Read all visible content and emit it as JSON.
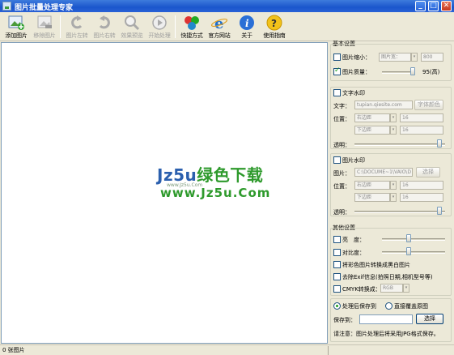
{
  "window": {
    "title": "图片批量处理专家",
    "min_glyph": "_",
    "max_glyph": "□",
    "close_glyph": "✕"
  },
  "toolbar": {
    "items": [
      {
        "label": "添加图片",
        "icon": "add-image-icon",
        "enabled": true
      },
      {
        "label": "移除图片",
        "icon": "remove-image-icon",
        "enabled": false
      },
      {
        "label": "图片左转",
        "icon": "rotate-left-icon",
        "enabled": false
      },
      {
        "label": "图片右转",
        "icon": "rotate-right-icon",
        "enabled": false
      },
      {
        "label": "效果预览",
        "icon": "magnifier-icon",
        "enabled": false
      },
      {
        "label": "开始处理",
        "icon": "play-icon",
        "enabled": false
      },
      {
        "label": "快捷方式",
        "icon": "shortcut-icon",
        "enabled": true
      },
      {
        "label": "官方网站",
        "icon": "ie-icon",
        "enabled": true
      },
      {
        "label": "关于",
        "icon": "info-icon",
        "enabled": true
      },
      {
        "label": "使用指南",
        "icon": "help-icon",
        "enabled": true
      }
    ]
  },
  "watermark": {
    "line1_a": "Jz5u",
    "line1_b": "绿色下载",
    "line2": "www.Jz5u.Com",
    "line3": "www.Jz5u.Com"
  },
  "panel": {
    "basic_title": "基本设置",
    "resize_label": "图片缩小：",
    "resize_width_label": "图片宽：",
    "resize_width_value": "800",
    "quality_label": "图片质量：",
    "quality_value": "95(高)",
    "quality_level": 0.95,
    "text_wm_title": "文字水印",
    "text_label": "文字：",
    "text_value": "tupian.qiesite.com",
    "font_color_btn": "字体颜色",
    "pos_label": "位置：",
    "right_margin": "右边距",
    "right_val": "16",
    "bottom_margin": "下边距",
    "bottom_val": "16",
    "opacity_label": "透明：",
    "img_wm_title": "图片水印",
    "image_label": "图片：",
    "image_path": "C:\\DOCUME~1\\VAIO\\D",
    "choose_btn": "选择",
    "other_title": "其他设置",
    "brightness_label": "亮　度：",
    "contrast_label": "对比度：",
    "grayscale_label": "将彩色图片转换成黑白图片",
    "exif_label": "去除Exif信息(拍照日期,相机型号等)",
    "cmyk_label": "CMYK转换成：",
    "cmyk_value": "RGB",
    "radio_save_to": "处理后保存到",
    "radio_overwrite": "直接覆盖原图",
    "save_to_label": "保存到：",
    "save_to_value": "",
    "save_choose_btn": "选择",
    "note": "请注意：图片处理后将采用JPG格式保存。"
  },
  "status": {
    "count": "0 张图片"
  }
}
